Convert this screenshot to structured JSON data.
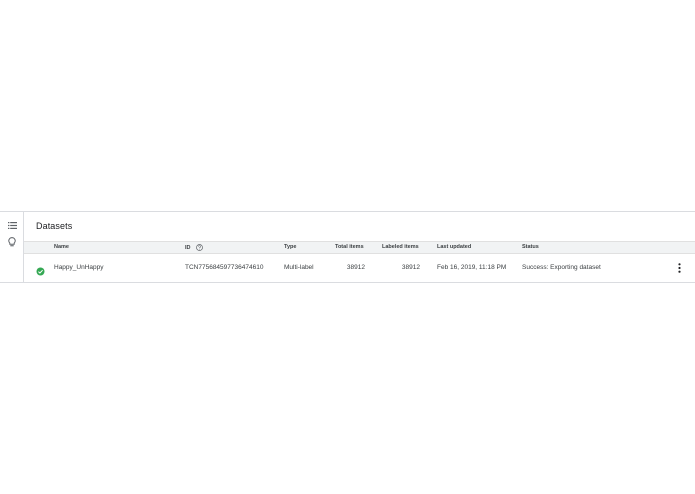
{
  "page": {
    "title": "Datasets"
  },
  "icons": {
    "rail_top": "list-icon",
    "rail_bottom": "lightbulb-icon",
    "status": "check-circle-icon",
    "help": "help-circle-icon",
    "more": "more-vert-icon"
  },
  "colors": {
    "success": "#34a853",
    "header_bg": "#f1f3f4",
    "divider": "#dadce0",
    "text": "#3c4043"
  },
  "table": {
    "columns": {
      "name": "Name",
      "id": "ID",
      "type": "Type",
      "total_items": "Total items",
      "labeled_items": "Labeled items",
      "last_updated": "Last updated",
      "status": "Status"
    },
    "rows": [
      {
        "name": "Happy_UnHappy",
        "id": "TCN775684597736474610",
        "type": "Multi-label",
        "total_items": "38912",
        "labeled_items": "38912",
        "last_updated": "Feb 16, 2019, 11:18 PM",
        "status": "Success: Exporting dataset"
      }
    ]
  }
}
